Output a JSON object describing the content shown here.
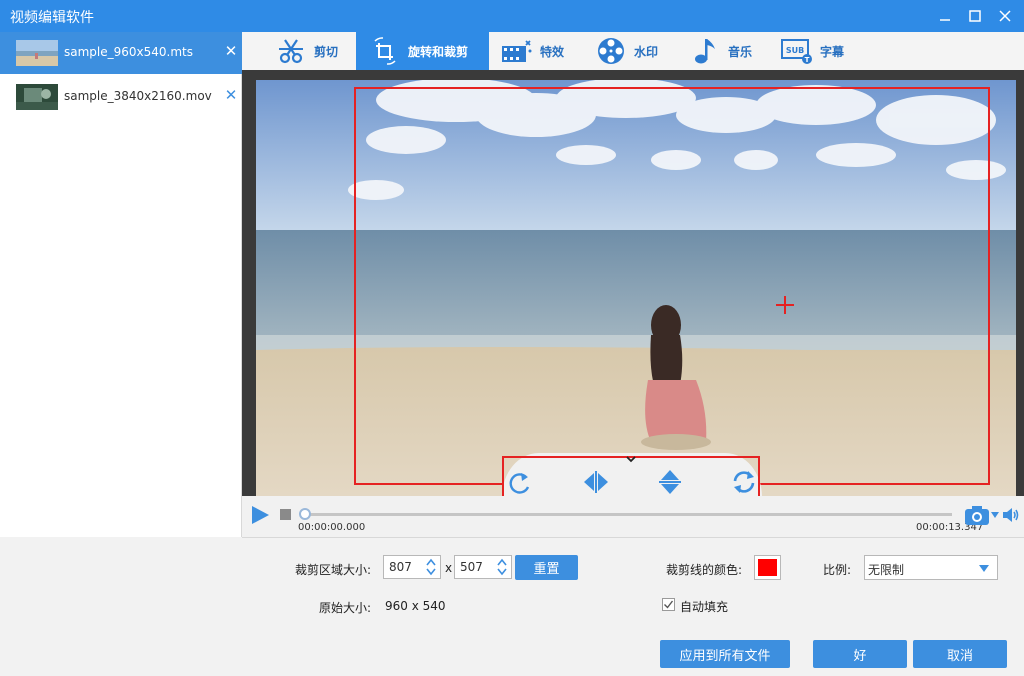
{
  "window": {
    "title": "视频编辑软件"
  },
  "files": [
    {
      "name": "sample_960x540.mts",
      "active": true
    },
    {
      "name": "sample_3840x2160.mov",
      "active": false
    }
  ],
  "tabs": [
    {
      "label": "剪切",
      "icon": "scissors-icon"
    },
    {
      "label": "旋转和裁剪",
      "icon": "crop-rotate-icon",
      "active": true
    },
    {
      "label": "特效",
      "icon": "effects-film-icon"
    },
    {
      "label": "水印",
      "icon": "watermark-film-reel-icon"
    },
    {
      "label": "音乐",
      "icon": "music-note-icon"
    },
    {
      "label": "字幕",
      "icon": "subtitle-icon"
    }
  ],
  "preview": {
    "tools": [
      "rotate-clockwise-icon",
      "flip-horizontal-icon",
      "flip-vertical-icon",
      "reset-rotation-icon"
    ]
  },
  "playback": {
    "current_time": "00:00:00.000",
    "total_time": "00:00:13.347",
    "progress": 0.0
  },
  "settings": {
    "crop_size_label": "裁剪区域大小:",
    "crop_width": "807",
    "times": "x",
    "crop_height": "507",
    "reset_label": "重置",
    "original_size_label": "原始大小:",
    "original_size": "960 x 540",
    "crop_color_label": "裁剪线的颜色:",
    "crop_color": "#ff0000",
    "ratio_label": "比例:",
    "ratio_value": "无限制",
    "auto_fill_label": "自动填充",
    "auto_fill_checked": true,
    "apply_all_label": "应用到所有文件",
    "ok_label": "好",
    "cancel_label": "取消"
  },
  "colors": {
    "accent": "#2f8be6",
    "crop_line": "#e52222"
  }
}
